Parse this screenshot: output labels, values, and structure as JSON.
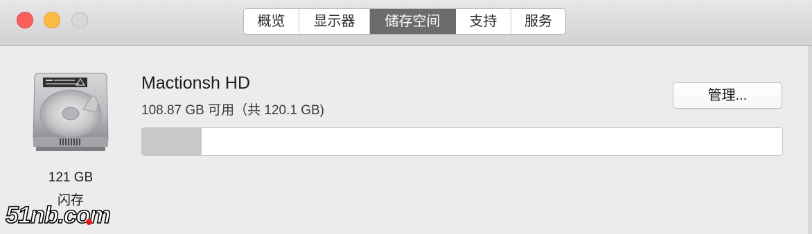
{
  "tabs": [
    {
      "label": "概览",
      "active": false
    },
    {
      "label": "显示器",
      "active": false
    },
    {
      "label": "储存空间",
      "active": true
    },
    {
      "label": "支持",
      "active": false
    },
    {
      "label": "服务",
      "active": false
    }
  ],
  "disk": {
    "size": "121 GB",
    "type": "闪存",
    "icon": "hard-drive-icon"
  },
  "volume": {
    "name": "Mactionsh HD",
    "space": "108.87 GB 可用（共 120.1 GB)",
    "used_fraction": 0.093
  },
  "manage_button": "管理...",
  "watermark": "51nb.com",
  "colors": {
    "close": "#fc605c",
    "minimize": "#fdbc40",
    "zoom_inactive": "#d9d7d9",
    "active_tab": "#6c6b6d",
    "used_fill": "#c8c8c8"
  }
}
